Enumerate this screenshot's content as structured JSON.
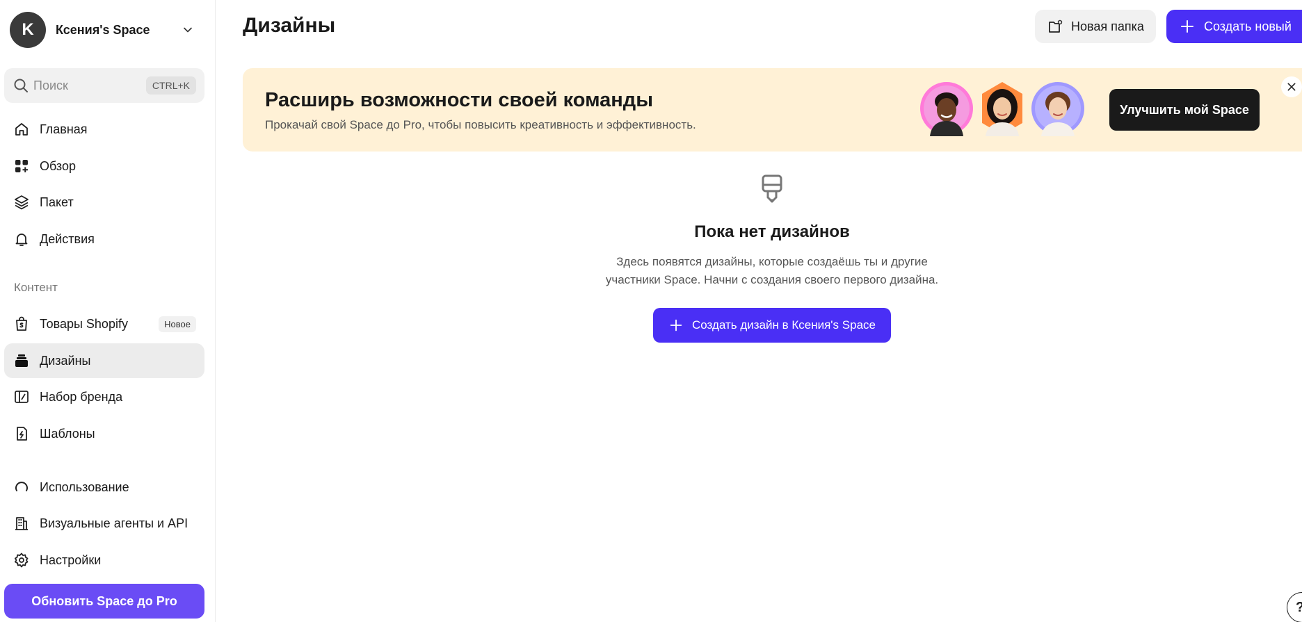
{
  "workspace": {
    "initial": "K",
    "name": "Ксения's Space"
  },
  "search": {
    "placeholder": "Поиск",
    "shortcut": "CTRL+K"
  },
  "nav_main": [
    {
      "label": "Главная",
      "icon": "home-icon"
    },
    {
      "label": "Обзор",
      "icon": "grid-icon"
    },
    {
      "label": "Пакет",
      "icon": "layers-icon"
    },
    {
      "label": "Действия",
      "icon": "bell-icon"
    }
  ],
  "content_section": {
    "label": "Контент",
    "items": [
      {
        "label": "Товары Shopify",
        "icon": "shopify-bag-icon",
        "badge": "Новое"
      },
      {
        "label": "Дизайны",
        "icon": "designs-stack-icon",
        "active": true
      },
      {
        "label": "Набор бренда",
        "icon": "brand-kit-icon"
      },
      {
        "label": "Шаблоны",
        "icon": "templates-icon"
      }
    ]
  },
  "nav_bottom": [
    {
      "label": "Использование",
      "icon": "usage-ring-icon"
    },
    {
      "label": "Визуальные агенты и API",
      "icon": "building-icon"
    },
    {
      "label": "Настройки",
      "icon": "gear-icon"
    }
  ],
  "upgrade_button": "Обновить Space до Pro",
  "header": {
    "title": "Дизайны",
    "new_folder": "Новая папка",
    "create_new": "Создать новый"
  },
  "banner": {
    "title": "Расширь возможности своей команды",
    "subtitle": "Прокачай свой Space до Pro, чтобы повысить креативность и эффективность.",
    "button": "Улучшить мой Space"
  },
  "empty_state": {
    "title": "Пока нет дизайнов",
    "description_line1": "Здесь появятся дизайны, которые создаёшь ты и другие",
    "description_line2": "участники Space. Начни с создания своего первого дизайна.",
    "button": "Создать дизайн в Ксения's Space"
  },
  "help": "?",
  "colors": {
    "primary": "#4a2ff5",
    "upgrade": "#6a4cf5",
    "banner_bg": "#fff1d6",
    "active_nav_bg": "#ececec"
  }
}
